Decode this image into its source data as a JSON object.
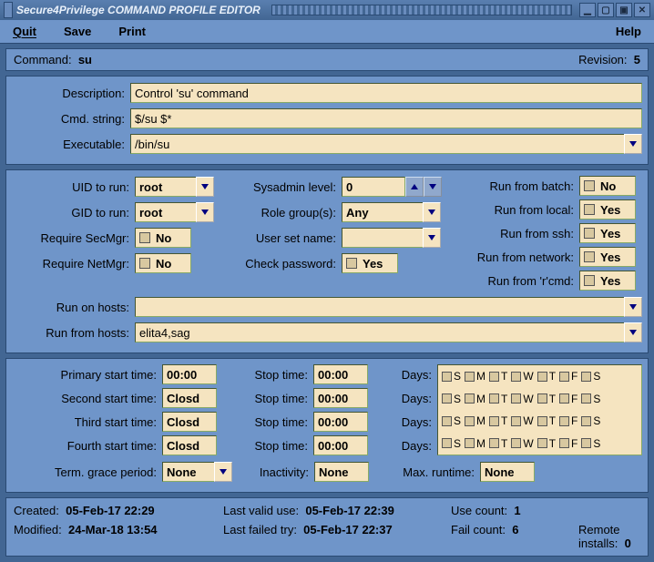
{
  "window": {
    "title": "Secure4Privilege COMMAND PROFILE EDITOR"
  },
  "menu": {
    "quit": "Quit",
    "save": "Save",
    "print": "Print",
    "help": "Help"
  },
  "head": {
    "command_label": "Command:",
    "command_value": "su",
    "revision_label": "Revision:",
    "revision_value": "5"
  },
  "desc": {
    "description_label": "Description:",
    "description": "Control 'su' command",
    "cmd_string_label": "Cmd. string:",
    "cmd_string": "$/su $*",
    "executable_label": "Executable:",
    "executable": "/bin/su"
  },
  "mid": {
    "uid_label": "UID to run:",
    "uid": "root",
    "gid_label": "GID to run:",
    "gid": "root",
    "reqsecmgr_label": "Require SecMgr:",
    "reqsecmgr": "No",
    "reqnetmgr_label": "Require NetMgr:",
    "reqnetmgr": "No",
    "sysadmin_label": "Sysadmin level:",
    "sysadmin": "0",
    "rolegroups_label": "Role group(s):",
    "rolegroups": "Any",
    "usersetname_label": "User set name:",
    "usersetname": "",
    "checkpw_label": "Check password:",
    "checkpw": "Yes",
    "run_batch_label": "Run from batch:",
    "run_batch": "No",
    "run_local_label": "Run from local:",
    "run_local": "Yes",
    "run_ssh_label": "Run from ssh:",
    "run_ssh": "Yes",
    "run_network_label": "Run from network:",
    "run_network": "Yes",
    "run_rcmd_label": "Run from 'r'cmd:",
    "run_rcmd": "Yes",
    "run_on_label": "Run on hosts:",
    "run_on": "",
    "run_from_label": "Run from hosts:",
    "run_from": "elita4,sag"
  },
  "sched": {
    "primary_label": "Primary start time:",
    "primary": "00:00",
    "primary_stop": "00:00",
    "second_label": "Second start time:",
    "second": "Closd",
    "second_stop": "00:00",
    "third_label": "Third start time:",
    "third": "Closd",
    "third_stop": "00:00",
    "fourth_label": "Fourth start time:",
    "fourth": "Closd",
    "fourth_stop": "00:00",
    "stop_label": "Stop time:",
    "days_label": "Days:",
    "days_letters": [
      "S",
      "M",
      "T",
      "W",
      "T",
      "F",
      "S"
    ],
    "term_label": "Term. grace period:",
    "term": "None",
    "inactivity_label": "Inactivity:",
    "inactivity": "None",
    "max_runtime_label": "Max. runtime:",
    "max_runtime": "None"
  },
  "footer": {
    "created_label": "Created:",
    "created": "05-Feb-17 22:29",
    "modified_label": "Modified:",
    "modified": "24-Mar-18 13:54",
    "lastvalid_label": "Last valid use:",
    "lastvalid": "05-Feb-17 22:39",
    "lastfail_label": "Last failed try:",
    "lastfail": "05-Feb-17 22:37",
    "usecount_label": "Use count:",
    "usecount": "1",
    "failcount_label": "Fail count:",
    "failcount": "6",
    "remote_label": "Remote installs:",
    "remote": "0"
  }
}
